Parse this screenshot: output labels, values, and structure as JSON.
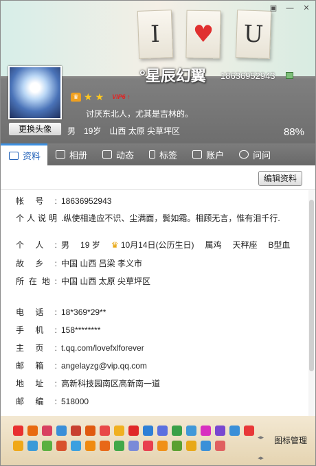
{
  "header": {
    "cards": [
      "I",
      "♥",
      "U"
    ],
    "nickname": "°星辰幻翼",
    "uin": "18636952943",
    "change_avatar": "更换头像",
    "vip_label": "VIP6 ↑",
    "signature": "讨厌东北人，尤其是吉林的。",
    "gender": "男",
    "age": "19岁",
    "location": "山西 太原 尖草坪区",
    "completion": "88%",
    "window_controls": [
      "▣",
      "—",
      "✕"
    ]
  },
  "tabs": [
    {
      "label": "资料",
      "icon": "profile-card-icon",
      "active": true
    },
    {
      "label": "相册",
      "icon": "album-icon"
    },
    {
      "label": "动态",
      "icon": "feed-icon"
    },
    {
      "label": "标签",
      "icon": "bookmark-icon"
    },
    {
      "label": "账户",
      "icon": "wallet-icon"
    },
    {
      "label": "问问",
      "icon": "question-icon"
    }
  ],
  "profile": {
    "edit_button": "编辑资料",
    "account": {
      "label": "帐号:",
      "value": "18636952943"
    },
    "description": {
      "label": "个人说明",
      "value": ".纵使相逢应不识、尘满面，鬓如霜。相顾无言，惟有泪千行."
    },
    "personal": {
      "label": "个人:",
      "gender": "男",
      "age": "19 岁",
      "birthday": "10月14日(公历生日)",
      "zodiac": "属鸡",
      "constellation": "天秤座",
      "blood": "B型血"
    },
    "hometown": {
      "label": "故乡:",
      "value": "中国 山西 吕梁 孝义市"
    },
    "residence": {
      "label": "所在地:",
      "value": "中国 山西 太原 尖草坪区"
    },
    "phone": {
      "label": "电话:",
      "value": "18*369*29**"
    },
    "mobile": {
      "label": "手机:",
      "value": "158********"
    },
    "homepage": {
      "label": "主页:",
      "value": "t.qq.com/lovefxlforever"
    },
    "email": {
      "label": "邮箱:",
      "value": "angelayzg@vip.qq.com"
    },
    "address": {
      "label": "地址:",
      "value": "高新科技园南区高新南一道"
    },
    "zip": {
      "label": "邮编:",
      "value": "518000"
    }
  },
  "footer": {
    "icon_manager": "图标管理",
    "badge_colors": [
      "#e83030",
      "#e86a10",
      "#d84060",
      "#3a8fd8",
      "#c84030",
      "#e05a10",
      "#e84848",
      "#f0b020",
      "#e02828",
      "#2d7fd6",
      "#5a70e0",
      "#3aa048",
      "#4098d8",
      "#d830c0",
      "#7848d0",
      "#3a8fd8",
      "#e83838",
      "#f0a818",
      "#3a9ad8",
      "#5ab040",
      "#d8502c",
      "#3aa0e0",
      "#f08a10",
      "#e86818",
      "#40a848",
      "#7a8ad8",
      "#e84050",
      "#f09018",
      "#5aa030",
      "#e8a818",
      "#3a90d8",
      "#e06060"
    ]
  }
}
